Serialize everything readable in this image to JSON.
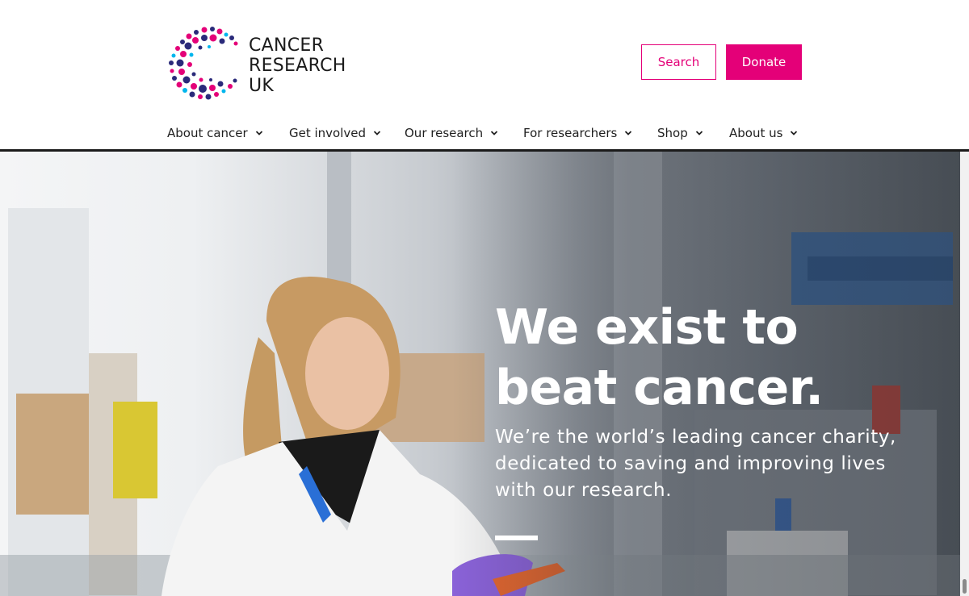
{
  "brand": {
    "name_line1": "CANCER",
    "name_line2": "RESEARCH",
    "name_line3": "UK",
    "colors": {
      "pink": "#e40078",
      "navy": "#2a2a7a",
      "blue": "#00b6ed"
    }
  },
  "header": {
    "search_label": "Search",
    "donate_label": "Donate"
  },
  "nav": {
    "items": [
      {
        "label": "About cancer",
        "icon": "chevron-down-icon"
      },
      {
        "label": "Get involved",
        "icon": "chevron-down-icon"
      },
      {
        "label": "Our research",
        "icon": "chevron-down-icon"
      },
      {
        "label": "For researchers",
        "icon": "chevron-down-icon"
      },
      {
        "label": "Shop",
        "icon": "chevron-down-icon"
      },
      {
        "label": "About us",
        "icon": "chevron-down-icon"
      }
    ]
  },
  "hero": {
    "title": "We exist to beat cancer.",
    "subtitle": "We’re the world’s leading cancer charity, dedicated to saving and improving lives with our research."
  }
}
